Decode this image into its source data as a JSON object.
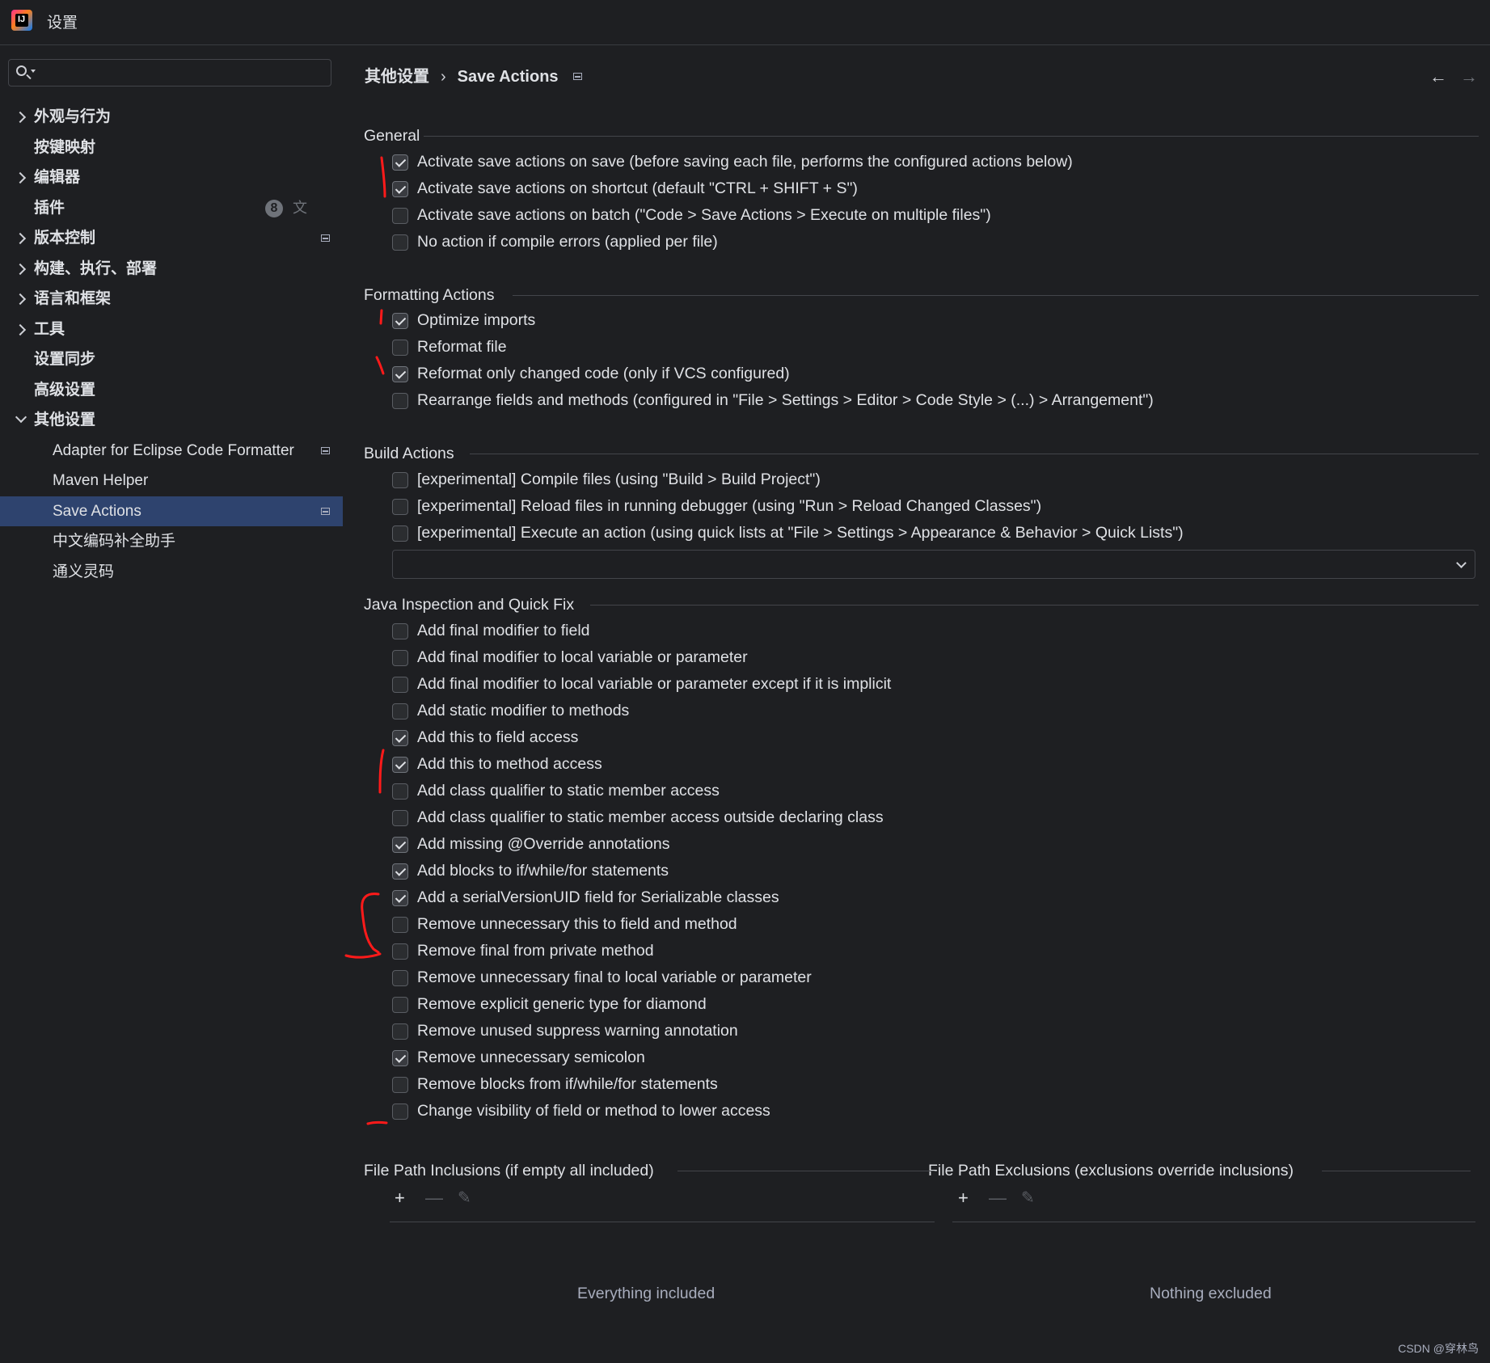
{
  "window": {
    "title": "设置"
  },
  "search": {
    "placeholder": ""
  },
  "sidebar": {
    "items": [
      {
        "label": "外观与行为",
        "chevron": "right"
      },
      {
        "label": "按键映射",
        "chevron": "none"
      },
      {
        "label": "编辑器",
        "chevron": "right"
      },
      {
        "label": "插件",
        "chevron": "none",
        "badge": "8"
      },
      {
        "label": "版本控制",
        "chevron": "right"
      },
      {
        "label": "构建、执行、部署",
        "chevron": "right"
      },
      {
        "label": "语言和框架",
        "chevron": "right"
      },
      {
        "label": "工具",
        "chevron": "right"
      },
      {
        "label": "设置同步",
        "chevron": "none"
      },
      {
        "label": "高级设置",
        "chevron": "none"
      },
      {
        "label": "其他设置",
        "chevron": "down"
      },
      {
        "label": "Adapter for Eclipse Code Formatter"
      },
      {
        "label": "Maven Helper"
      },
      {
        "label": "Save Actions"
      },
      {
        "label": "中文编码补全助手"
      },
      {
        "label": "通义灵码"
      }
    ]
  },
  "breadcrumb": {
    "parent": "其他设置",
    "separator": "›",
    "current": "Save Actions"
  },
  "sections": {
    "general": {
      "title": "General",
      "options": [
        {
          "label": "Activate save actions on save (before saving each file, performs the configured actions below)",
          "checked": true
        },
        {
          "label": "Activate save actions on shortcut (default \"CTRL + SHIFT + S\")",
          "checked": true
        },
        {
          "label": "Activate save actions on batch (\"Code > Save Actions > Execute on multiple files\")",
          "checked": false
        },
        {
          "label": "No action if compile errors (applied per file)",
          "checked": false
        }
      ]
    },
    "formatting": {
      "title": "Formatting Actions",
      "options": [
        {
          "label": "Optimize imports",
          "checked": true
        },
        {
          "label": "Reformat file",
          "checked": false
        },
        {
          "label": "Reformat only changed code (only if VCS configured)",
          "checked": true
        },
        {
          "label": "Rearrange fields and methods (configured in \"File > Settings > Editor > Code Style > (...) > Arrangement\")",
          "checked": false
        }
      ]
    },
    "build": {
      "title": "Build Actions",
      "options": [
        {
          "label": "[experimental] Compile files (using \"Build > Build Project\")",
          "checked": false
        },
        {
          "label": "[experimental] Reload files in running debugger (using \"Run > Reload Changed Classes\")",
          "checked": false
        },
        {
          "label": "[experimental] Execute an action (using quick lists at \"File > Settings > Appearance & Behavior > Quick Lists\")",
          "checked": false
        }
      ],
      "quick_list_value": ""
    },
    "java": {
      "title": "Java Inspection and Quick Fix",
      "options": [
        {
          "label": "Add final modifier to field",
          "checked": false
        },
        {
          "label": "Add final modifier to local variable or parameter",
          "checked": false
        },
        {
          "label": "Add final modifier to local variable or parameter except if it is implicit",
          "checked": false
        },
        {
          "label": "Add static modifier to methods",
          "checked": false
        },
        {
          "label": "Add this to field access",
          "checked": true
        },
        {
          "label": "Add this to method access",
          "checked": true
        },
        {
          "label": "Add class qualifier to static member access",
          "checked": false
        },
        {
          "label": "Add class qualifier to static member access outside declaring class",
          "checked": false
        },
        {
          "label": "Add missing @Override annotations",
          "checked": true
        },
        {
          "label": "Add blocks to if/while/for statements",
          "checked": true
        },
        {
          "label": "Add a serialVersionUID field for Serializable classes",
          "checked": true
        },
        {
          "label": "Remove unnecessary this to field and method",
          "checked": false
        },
        {
          "label": "Remove final from private method",
          "checked": false
        },
        {
          "label": "Remove unnecessary final to local variable or parameter",
          "checked": false
        },
        {
          "label": "Remove explicit generic type for diamond",
          "checked": false
        },
        {
          "label": "Remove unused suppress warning annotation",
          "checked": false
        },
        {
          "label": "Remove unnecessary semicolon",
          "checked": true
        },
        {
          "label": "Remove blocks from if/while/for statements",
          "checked": false
        },
        {
          "label": "Change visibility of field or method to lower access",
          "checked": false
        }
      ]
    },
    "inclusions": {
      "title": "File Path Inclusions (if empty all included)",
      "empty_text": "Everything included"
    },
    "exclusions": {
      "title": "File Path Exclusions (exclusions override inclusions)",
      "empty_text": "Nothing excluded"
    }
  },
  "watermark": "CSDN @穿林鸟",
  "colors": {
    "background": "#1e1f22",
    "selection": "#2e436e",
    "annotation": "#ff0000"
  }
}
